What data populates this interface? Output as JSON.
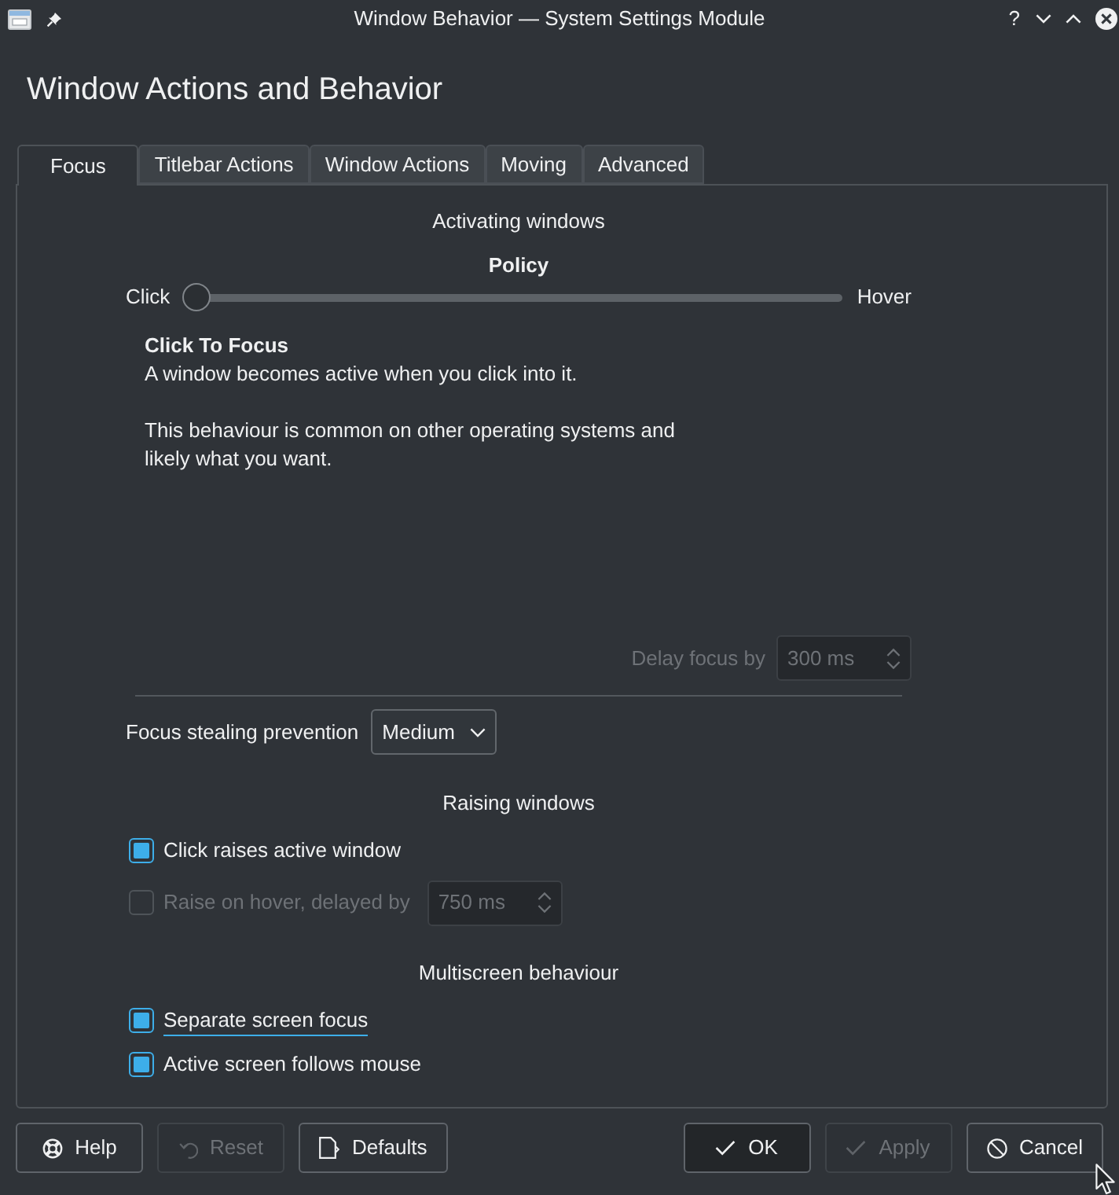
{
  "window": {
    "title": "Window Behavior — System Settings Module",
    "help_button": "?"
  },
  "heading": "Window Actions and Behavior",
  "tabs": [
    {
      "label": "Focus",
      "selected": true
    },
    {
      "label": "Titlebar Actions",
      "selected": false
    },
    {
      "label": "Window Actions",
      "selected": false
    },
    {
      "label": "Moving",
      "selected": false
    },
    {
      "label": "Advanced",
      "selected": false
    }
  ],
  "activating": {
    "title": "Activating windows",
    "policy": {
      "label": "Policy",
      "min_label": "Click",
      "max_label": "Hover",
      "level": 0
    },
    "description": {
      "title": "Click To Focus",
      "paragraphs": [
        "A window becomes active when you click into it.",
        "This behaviour is common on other operating systems and likely what you want."
      ]
    },
    "delay": {
      "label": "Delay focus by",
      "value": "300 ms",
      "disabled": true
    }
  },
  "focus_stealing": {
    "label": "Focus stealing prevention",
    "value": "Medium"
  },
  "raising": {
    "title": "Raising windows",
    "options": [
      {
        "kind": "checkbox",
        "label": "Click raises active window",
        "checked": true,
        "disabled": false,
        "focused": false
      },
      {
        "kind": "checkbox_spin",
        "label": "Raise on hover, delayed by",
        "checked": false,
        "disabled": true,
        "focused": false,
        "value": "750 ms"
      }
    ]
  },
  "multiscreen": {
    "title": "Multiscreen behaviour",
    "options": [
      {
        "kind": "checkbox",
        "label": "Separate screen focus",
        "checked": true,
        "disabled": false,
        "focused": true
      },
      {
        "kind": "checkbox",
        "label": "Active screen follows mouse",
        "checked": true,
        "disabled": false,
        "focused": false
      }
    ]
  },
  "buttons_left": [
    {
      "kind": "help",
      "label": "Help",
      "disabled": false,
      "default": false
    },
    {
      "kind": "reset",
      "label": "Reset",
      "disabled": true,
      "default": false
    },
    {
      "kind": "defaults",
      "label": "Defaults",
      "disabled": false,
      "default": false
    }
  ],
  "buttons_right": [
    {
      "kind": "ok",
      "label": "OK",
      "disabled": false,
      "default": true
    },
    {
      "kind": "apply",
      "label": "Apply",
      "disabled": true,
      "default": false
    },
    {
      "kind": "cancel",
      "label": "Cancel",
      "disabled": false,
      "default": false
    }
  ]
}
